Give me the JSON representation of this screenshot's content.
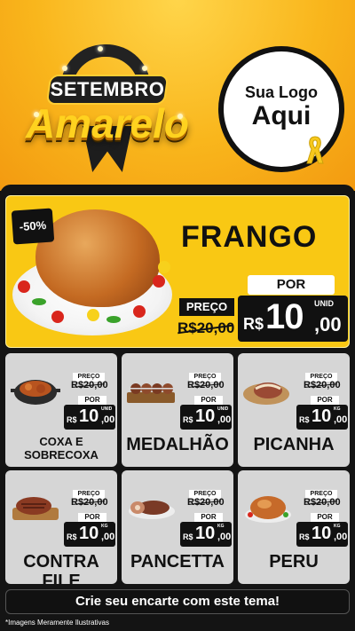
{
  "header": {
    "line1": "SETEMBRO",
    "line2": "Amarelo",
    "logo_line1": "Sua Logo",
    "logo_line2": "Aqui"
  },
  "hero": {
    "discount": "-50%",
    "name": "FRANGO",
    "preco_label": "PREÇO",
    "old_price": "R$20,00",
    "por_label": "POR",
    "currency": "R$",
    "price_int": "10",
    "price_dec": ",00",
    "unit": "UNID"
  },
  "products": [
    {
      "name": "COXA E SOBRECOXA",
      "preco_label": "PREÇO",
      "old_price": "R$20,00",
      "por_label": "POR",
      "currency": "R$",
      "price_int": "10",
      "price_dec": ",00",
      "unit": "UNID"
    },
    {
      "name": "MEDALHÃO",
      "preco_label": "PREÇO",
      "old_price": "R$20,00",
      "por_label": "POR",
      "currency": "R$",
      "price_int": "10",
      "price_dec": ",00",
      "unit": "UNID"
    },
    {
      "name": "PICANHA",
      "preco_label": "PREÇO",
      "old_price": "R$20,00",
      "por_label": "POR",
      "currency": "R$",
      "price_int": "10",
      "price_dec": ",00",
      "unit": "KG"
    },
    {
      "name": "CONTRA FILE",
      "preco_label": "PREÇO",
      "old_price": "R$20,00",
      "por_label": "POR",
      "currency": "R$",
      "price_int": "10",
      "price_dec": ",00",
      "unit": "KG"
    },
    {
      "name": "PANCETTA",
      "preco_label": "PREÇO",
      "old_price": "R$20,00",
      "por_label": "POR",
      "currency": "R$",
      "price_int": "10",
      "price_dec": ",00",
      "unit": "KG"
    },
    {
      "name": "PERU",
      "preco_label": "PREÇO",
      "old_price": "R$20,00",
      "por_label": "POR",
      "currency": "R$",
      "price_int": "10",
      "price_dec": ",00",
      "unit": "KG"
    }
  ],
  "footer": {
    "cta": "Crie seu encarte com este tema!",
    "disclaimer": "*Imagens Meramente Ilustrativas"
  },
  "colors": {
    "yellow": "#f9c814",
    "dark": "#111111",
    "card": "#d6d6d6"
  }
}
